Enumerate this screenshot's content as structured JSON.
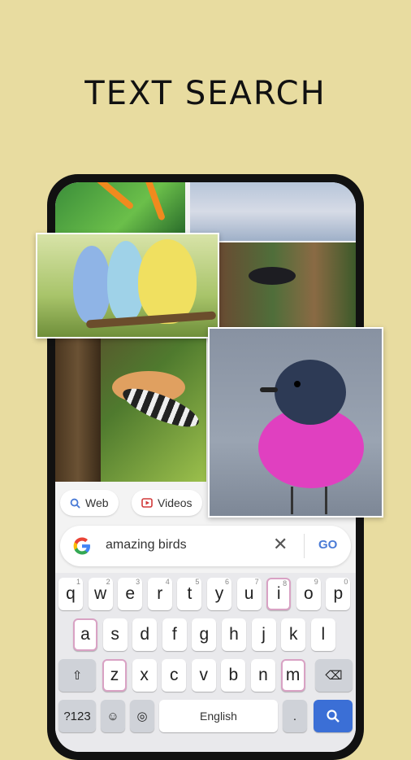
{
  "headline": "TEXT SEARCH",
  "chips": {
    "web": "Web",
    "videos": "Videos"
  },
  "search": {
    "query": "amazing birds",
    "go_label": "GO",
    "clear_glyph": "✕"
  },
  "keyboard": {
    "row1": [
      {
        "k": "q",
        "s": "1"
      },
      {
        "k": "w",
        "s": "2"
      },
      {
        "k": "e",
        "s": "3"
      },
      {
        "k": "r",
        "s": "4"
      },
      {
        "k": "t",
        "s": "5"
      },
      {
        "k": "y",
        "s": "6"
      },
      {
        "k": "u",
        "s": "7"
      },
      {
        "k": "i",
        "s": "8"
      },
      {
        "k": "o",
        "s": "9"
      },
      {
        "k": "p",
        "s": "0"
      }
    ],
    "row2": [
      "a",
      "s",
      "d",
      "f",
      "g",
      "h",
      "j",
      "k",
      "l"
    ],
    "row3": [
      "z",
      "x",
      "c",
      "v",
      "b",
      "n",
      "m"
    ],
    "symbols_label": "?123",
    "emoji_label": "☺",
    "space_label": "English",
    "period_label": ".",
    "shift_glyph": "⇧",
    "backspace_glyph": "⌫",
    "search_glyph": "⌕",
    "globe_glyph": "◎",
    "comma_label": ","
  },
  "icons": {
    "search": "search-icon",
    "videos": "play-icon",
    "google": "google-logo-icon"
  }
}
